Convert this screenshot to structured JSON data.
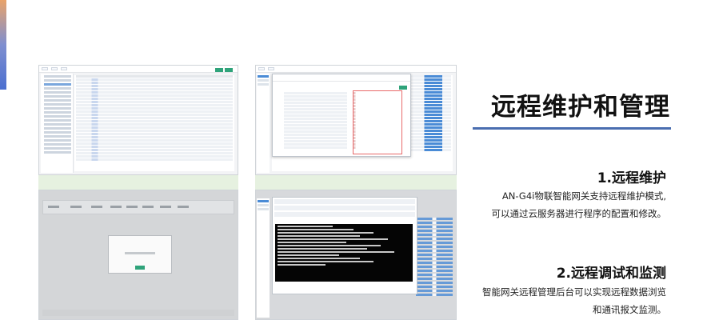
{
  "title": "远程维护和管理",
  "sections": [
    {
      "heading": "1.远程维护",
      "lines": [
        "AN-G4i物联智能网关支持远程维护模式,",
        "可以通过云服务器进行程序的配置和修改。"
      ]
    },
    {
      "heading": "2.远程调试和监测",
      "lines": [
        "智能网关远程管理后台可以实现远程数据浏览",
        "和通讯报文监测。"
      ]
    }
  ],
  "screenshots": [
    "web-config-table",
    "device-modal-list",
    "tabs-with-dialog",
    "terminal-monitor"
  ],
  "colors": {
    "rule": "#4a6eb0",
    "accent_green": "#2fa37a",
    "link_blue": "#4a8bd6"
  }
}
